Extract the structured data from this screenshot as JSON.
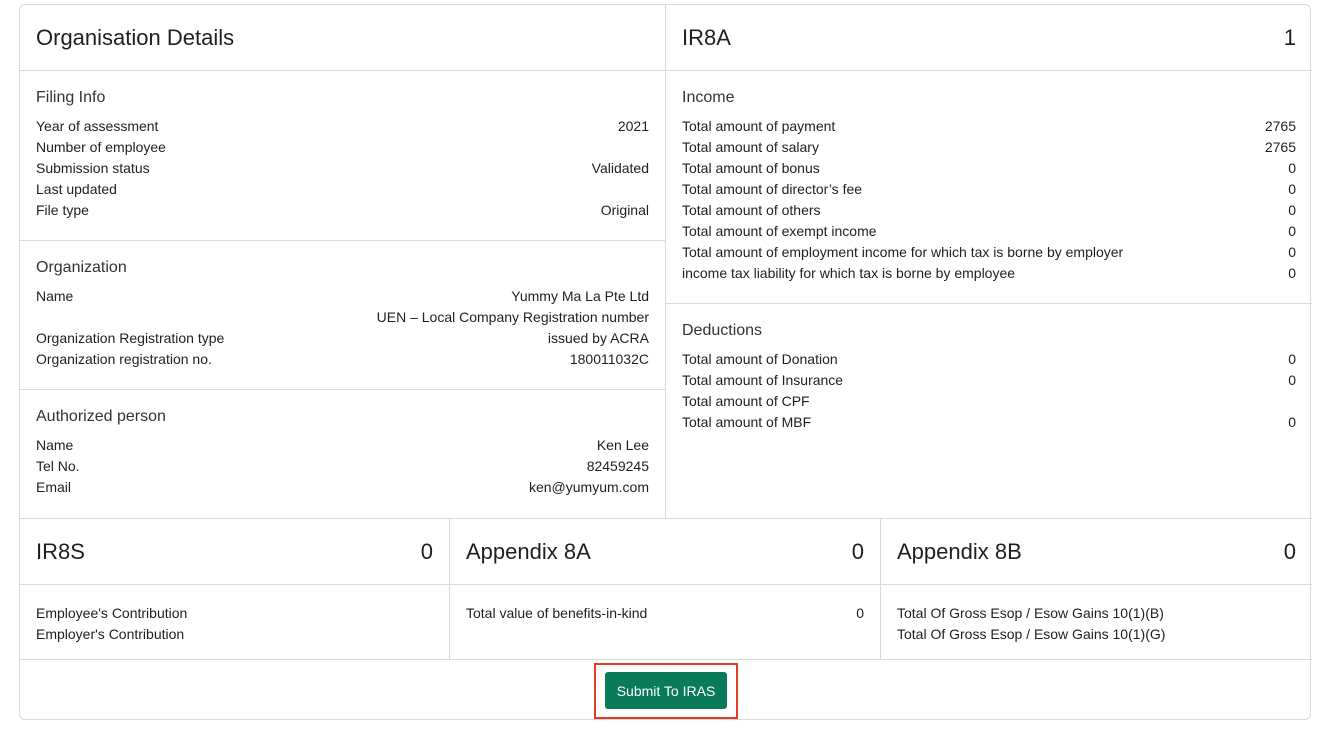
{
  "organisation": {
    "title": "Organisation Details",
    "filing_info": {
      "title": "Filing Info",
      "rows": [
        {
          "label": "Year of assessment",
          "value": "2021"
        },
        {
          "label": "Number of employee",
          "value": ""
        },
        {
          "label": "Submission status",
          "value": "Validated"
        },
        {
          "label": "Last updated",
          "value": ""
        },
        {
          "label": "File type",
          "value": "Original"
        }
      ]
    },
    "organization": {
      "title": "Organization",
      "name_label": "Name",
      "name_value": "Yummy Ma La Pte Ltd",
      "reg_type_label": "Organization Registration type",
      "reg_type_value_line1": "UEN – Local Company Registration number",
      "reg_type_value_line2": "issued by ACRA",
      "reg_no_label": "Organization registration no.",
      "reg_no_value": "180011032C"
    },
    "authorized_person": {
      "title": "Authorized person",
      "rows": [
        {
          "label": "Name",
          "value": "Ken Lee"
        },
        {
          "label": "Tel No.",
          "value": "82459245"
        },
        {
          "label": "Email",
          "value": "ken@yumyum.com"
        }
      ]
    }
  },
  "ir8a": {
    "title": "IR8A",
    "count": "1",
    "income": {
      "title": "Income",
      "rows": [
        {
          "label": "Total amount of payment",
          "value": "2765"
        },
        {
          "label": "Total amount of salary",
          "value": "2765"
        },
        {
          "label": "Total amount of bonus",
          "value": "0"
        },
        {
          "label": "Total amount of director’s fee",
          "value": "0"
        },
        {
          "label": "Total amount of others",
          "value": "0"
        },
        {
          "label": "Total amount of exempt income",
          "value": "0"
        },
        {
          "label": "Total amount of employment income for which tax is borne by employer",
          "value": "0"
        },
        {
          "label": "income tax liability for which tax is borne by employee",
          "value": "0"
        }
      ]
    },
    "deductions": {
      "title": "Deductions",
      "rows": [
        {
          "label": "Total amount of Donation",
          "value": "0"
        },
        {
          "label": "Total amount of Insurance",
          "value": "0"
        },
        {
          "label": "Total amount of CPF",
          "value": ""
        },
        {
          "label": "Total amount of MBF",
          "value": "0"
        }
      ]
    }
  },
  "ir8s": {
    "title": "IR8S",
    "count": "0",
    "rows": [
      {
        "label": "Employee's Contribution",
        "value": ""
      },
      {
        "label": "Employer's Contribution",
        "value": ""
      }
    ]
  },
  "appendix8a": {
    "title": "Appendix 8A",
    "count": "0",
    "rows": [
      {
        "label": "Total value of benefits-in-kind",
        "value": "0"
      }
    ]
  },
  "appendix8b": {
    "title": "Appendix 8B",
    "count": "0",
    "rows": [
      {
        "label": "Total Of Gross Esop / Esow Gains 10(1)(B)",
        "value": ""
      },
      {
        "label": "Total Of Gross Esop / Esow Gains 10(1)(G)",
        "value": ""
      }
    ]
  },
  "footer": {
    "submit_label": "Submit To IRAS"
  },
  "colors": {
    "accent": "#097a5a",
    "highlight": "#e53b1e",
    "border": "#d9d9d9"
  }
}
